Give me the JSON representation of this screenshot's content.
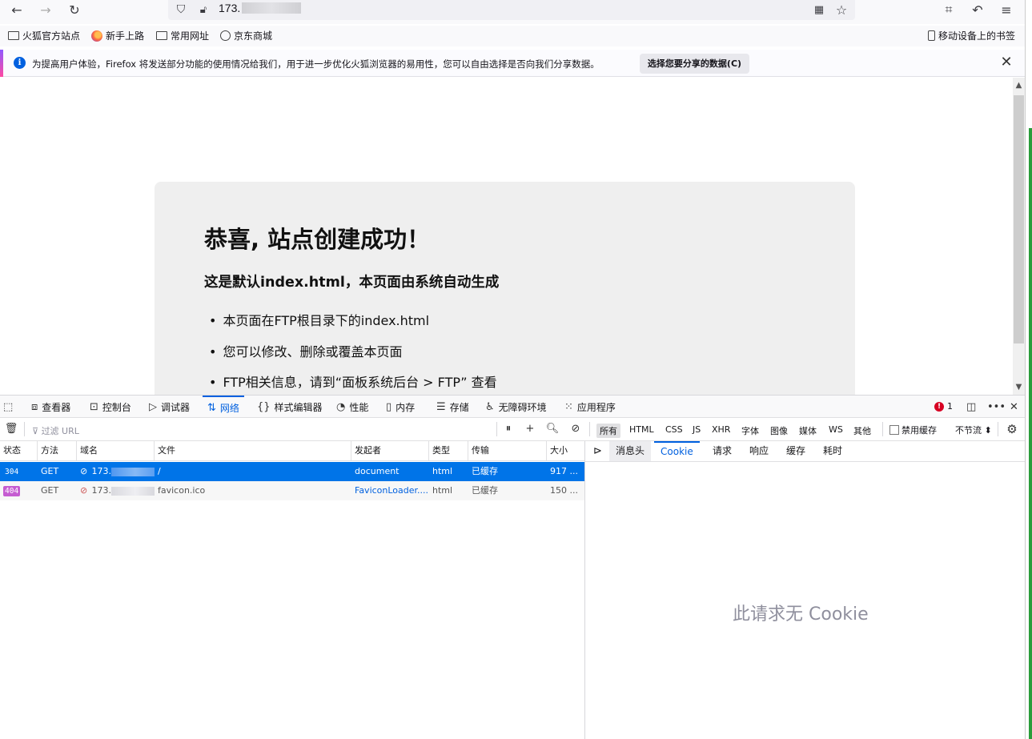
{
  "browser": {
    "url_visible": "173.",
    "bookmarks": [
      {
        "label": "火狐官方站点",
        "icon": "folder-icon"
      },
      {
        "label": "新手上路",
        "icon": "firefox-icon"
      },
      {
        "label": "常用网址",
        "icon": "folder-icon"
      },
      {
        "label": "京东商城",
        "icon": "globe-icon"
      }
    ],
    "mobile_bookmarks": "移动设备上的书签"
  },
  "notification": {
    "text": "为提高用户体验，Firefox 将发送部分功能的使用情况给我们，用于进一步优化火狐浏览器的易用性，您可以自由选择是否向我们分享数据。",
    "button": "选择您要分享的数据(C)"
  },
  "page": {
    "title": "恭喜, 站点创建成功！",
    "subtitle": "这是默认index.html，本页面由系统自动生成",
    "items": [
      "本页面在FTP根目录下的index.html",
      "您可以修改、删除或覆盖本页面",
      "FTP相关信息，请到“面板系统后台 > FTP” 查看"
    ]
  },
  "devtools": {
    "tabs": [
      "查看器",
      "控制台",
      "调试器",
      "网络",
      "样式编辑器",
      "性能",
      "内存",
      "存储",
      "无障碍环境",
      "应用程序"
    ],
    "selected_tab": "网络",
    "error_count": "1",
    "filter_placeholder": "过滤 URL",
    "filter_types": [
      "所有",
      "HTML",
      "CSS",
      "JS",
      "XHR",
      "字体",
      "图像",
      "媒体",
      "WS",
      "其他"
    ],
    "disable_cache": "禁用缓存",
    "throttle": "不节流 ⬍",
    "columns": [
      "状态",
      "方法",
      "域名",
      "文件",
      "发起者",
      "类型",
      "传输",
      "大小"
    ],
    "requests": [
      {
        "status": "304",
        "method": "GET",
        "domain": "173.",
        "file": "/",
        "initiator": "document",
        "type": "html",
        "transfer": "已缓存",
        "size": "917 ..."
      },
      {
        "status": "404",
        "method": "GET",
        "domain": "173.",
        "file": "favicon.ico",
        "initiator": "FaviconLoader....",
        "type": "html",
        "transfer": "已缓存",
        "size": "150 ..."
      }
    ],
    "side_tabs": [
      "消息头",
      "Cookie",
      "请求",
      "响应",
      "缓存",
      "耗时"
    ],
    "side_selected": "Cookie",
    "empty_message": "此请求无 Cookie"
  }
}
